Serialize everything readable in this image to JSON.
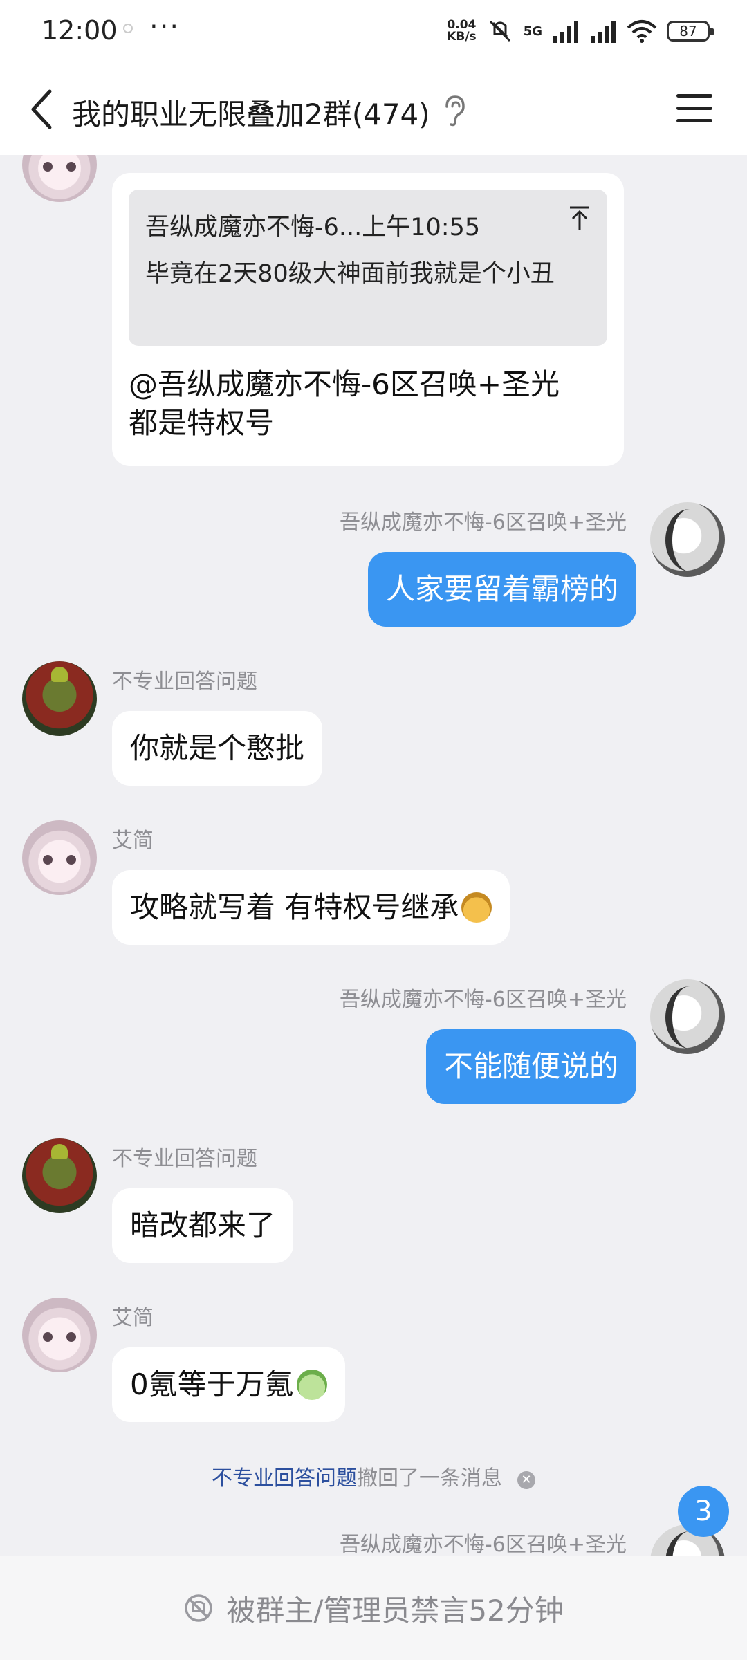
{
  "status_bar": {
    "time": "12:00",
    "dots": "···",
    "net_speed_value": "0.04",
    "net_speed_unit": "KB/s",
    "network": "5G",
    "battery": "87"
  },
  "header": {
    "title": "我的职业无限叠加2群(474)"
  },
  "messages": [
    {
      "kind": "quote",
      "quote_header": "吾纵成魔亦不悔-6...上午10:55",
      "quote_text": "毕竟在2天80级大神面前我就是个小丑",
      "reply_line1": "@吾纵成魔亦不悔-6区召唤+圣光",
      "reply_line2": "都是特权号"
    },
    {
      "kind": "out",
      "sender": "吾纵成魔亦不悔-6区召唤+圣光",
      "text": "人家要留着霸榜的"
    },
    {
      "kind": "in",
      "sender": "不专业回答问题",
      "text": "你就是个憨批"
    },
    {
      "kind": "in",
      "sender": "艾简",
      "text": "攻略就写着 有特权号继承"
    },
    {
      "kind": "out",
      "sender": "吾纵成魔亦不悔-6区召唤+圣光",
      "text": "不能随便说的"
    },
    {
      "kind": "in",
      "sender": "不专业回答问题",
      "text": "暗改都来了"
    },
    {
      "kind": "in",
      "sender": "艾简",
      "text": "0氪等于万氪"
    },
    {
      "kind": "recall",
      "name": "不专业回答问题",
      "text": "撤回了一条消息"
    },
    {
      "kind": "out-partial",
      "sender": "吾纵成魔亦不悔-6区召唤+圣光"
    }
  ],
  "unread_count": "3",
  "mute_bar": {
    "text": "被群主/管理员禁言52分钟"
  },
  "colors": {
    "accent": "#3a96f2",
    "background": "#f0f0f3",
    "recall_name": "#2c4f9e"
  },
  "icons": {
    "back": "back-arrow-icon",
    "ear": "ear-icon",
    "menu": "menu-icon",
    "quote_up": "arrow-up-icon",
    "mute": "mute-icon"
  }
}
